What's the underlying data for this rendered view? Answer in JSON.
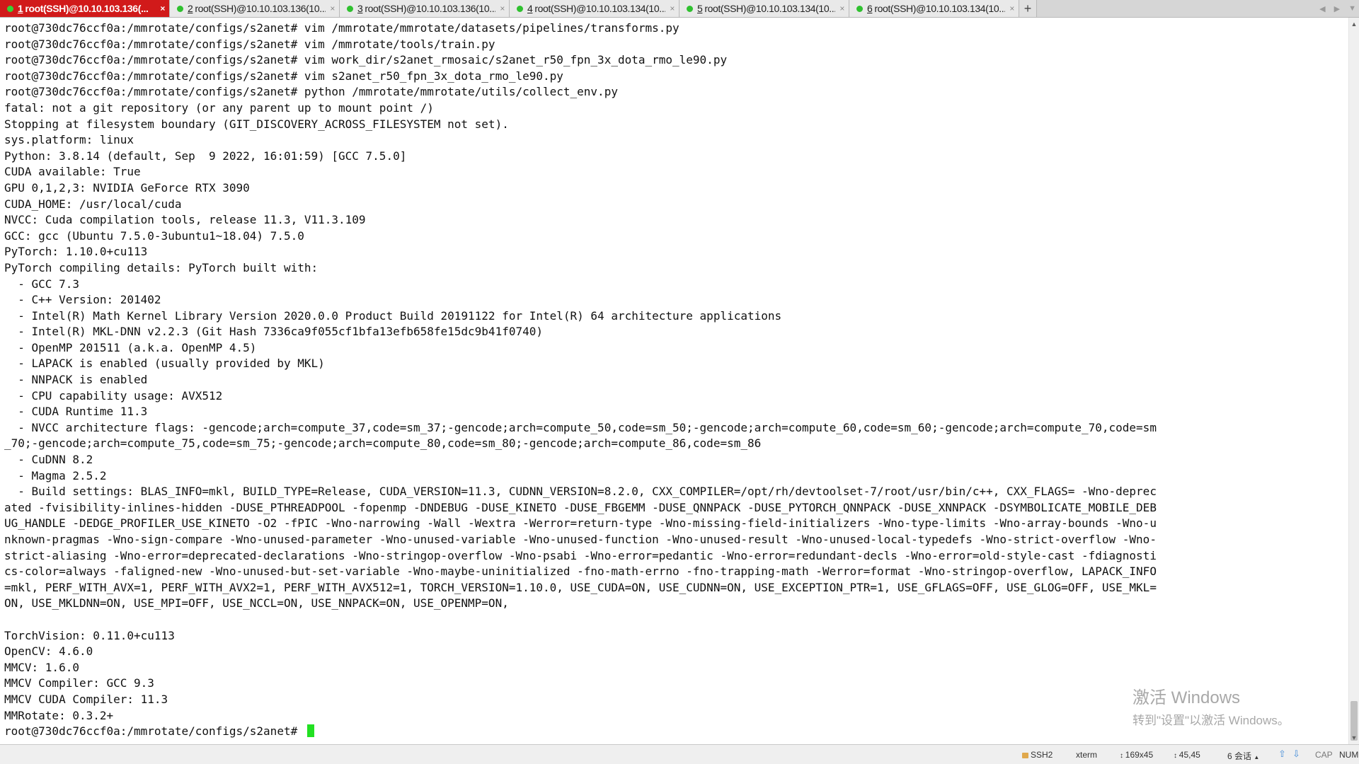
{
  "tabs": [
    {
      "num": "1",
      "title": "root(SSH)@10.10.103.136(...",
      "active": true
    },
    {
      "num": "2",
      "title": "root(SSH)@10.10.103.136(10...",
      "active": false
    },
    {
      "num": "3",
      "title": "root(SSH)@10.10.103.136(10...",
      "active": false
    },
    {
      "num": "4",
      "title": "root(SSH)@10.10.103.134(10...",
      "active": false
    },
    {
      "num": "5",
      "title": "root(SSH)@10.10.103.134(10...",
      "active": false
    },
    {
      "num": "6",
      "title": "root(SSH)@10.10.103.134(10...",
      "active": false
    }
  ],
  "tab_close_glyph": "×",
  "new_tab_glyph": "+",
  "terminal": {
    "lines": [
      "root@730dc76ccf0a:/mmrotate/configs/s2anet# vim /mmrotate/mmrotate/datasets/pipelines/transforms.py",
      "root@730dc76ccf0a:/mmrotate/configs/s2anet# vim /mmrotate/tools/train.py",
      "root@730dc76ccf0a:/mmrotate/configs/s2anet# vim work_dir/s2anet_rmosaic/s2anet_r50_fpn_3x_dota_rmo_le90.py",
      "root@730dc76ccf0a:/mmrotate/configs/s2anet# vim s2anet_r50_fpn_3x_dota_rmo_le90.py",
      "root@730dc76ccf0a:/mmrotate/configs/s2anet# python /mmrotate/mmrotate/utils/collect_env.py",
      "fatal: not a git repository (or any parent up to mount point /)",
      "Stopping at filesystem boundary (GIT_DISCOVERY_ACROSS_FILESYSTEM not set).",
      "sys.platform: linux",
      "Python: 3.8.14 (default, Sep  9 2022, 16:01:59) [GCC 7.5.0]",
      "CUDA available: True",
      "GPU 0,1,2,3: NVIDIA GeForce RTX 3090",
      "CUDA_HOME: /usr/local/cuda",
      "NVCC: Cuda compilation tools, release 11.3, V11.3.109",
      "GCC: gcc (Ubuntu 7.5.0-3ubuntu1~18.04) 7.5.0",
      "PyTorch: 1.10.0+cu113",
      "PyTorch compiling details: PyTorch built with:",
      "  - GCC 7.3",
      "  - C++ Version: 201402",
      "  - Intel(R) Math Kernel Library Version 2020.0.0 Product Build 20191122 for Intel(R) 64 architecture applications",
      "  - Intel(R) MKL-DNN v2.2.3 (Git Hash 7336ca9f055cf1bfa13efb658fe15dc9b41f0740)",
      "  - OpenMP 201511 (a.k.a. OpenMP 4.5)",
      "  - LAPACK is enabled (usually provided by MKL)",
      "  - NNPACK is enabled",
      "  - CPU capability usage: AVX512",
      "  - CUDA Runtime 11.3",
      "  - NVCC architecture flags: -gencode;arch=compute_37,code=sm_37;-gencode;arch=compute_50,code=sm_50;-gencode;arch=compute_60,code=sm_60;-gencode;arch=compute_70,code=sm",
      "_70;-gencode;arch=compute_75,code=sm_75;-gencode;arch=compute_80,code=sm_80;-gencode;arch=compute_86,code=sm_86",
      "  - CuDNN 8.2",
      "  - Magma 2.5.2",
      "  - Build settings: BLAS_INFO=mkl, BUILD_TYPE=Release, CUDA_VERSION=11.3, CUDNN_VERSION=8.2.0, CXX_COMPILER=/opt/rh/devtoolset-7/root/usr/bin/c++, CXX_FLAGS= -Wno-deprec",
      "ated -fvisibility-inlines-hidden -DUSE_PTHREADPOOL -fopenmp -DNDEBUG -DUSE_KINETO -DUSE_FBGEMM -DUSE_QNNPACK -DUSE_PYTORCH_QNNPACK -DUSE_XNNPACK -DSYMBOLICATE_MOBILE_DEB",
      "UG_HANDLE -DEDGE_PROFILER_USE_KINETO -O2 -fPIC -Wno-narrowing -Wall -Wextra -Werror=return-type -Wno-missing-field-initializers -Wno-type-limits -Wno-array-bounds -Wno-u",
      "nknown-pragmas -Wno-sign-compare -Wno-unused-parameter -Wno-unused-variable -Wno-unused-function -Wno-unused-result -Wno-unused-local-typedefs -Wno-strict-overflow -Wno-",
      "strict-aliasing -Wno-error=deprecated-declarations -Wno-stringop-overflow -Wno-psabi -Wno-error=pedantic -Wno-error=redundant-decls -Wno-error=old-style-cast -fdiagnosti",
      "cs-color=always -faligned-new -Wno-unused-but-set-variable -Wno-maybe-uninitialized -fno-math-errno -fno-trapping-math -Werror=format -Wno-stringop-overflow, LAPACK_INFO",
      "=mkl, PERF_WITH_AVX=1, PERF_WITH_AVX2=1, PERF_WITH_AVX512=1, TORCH_VERSION=1.10.0, USE_CUDA=ON, USE_CUDNN=ON, USE_EXCEPTION_PTR=1, USE_GFLAGS=OFF, USE_GLOG=OFF, USE_MKL=",
      "ON, USE_MKLDNN=ON, USE_MPI=OFF, USE_NCCL=ON, USE_NNPACK=ON, USE_OPENMP=ON,",
      "",
      "TorchVision: 0.11.0+cu113",
      "OpenCV: 4.6.0",
      "MMCV: 1.6.0",
      "MMCV Compiler: GCC 9.3",
      "MMCV CUDA Compiler: 11.3",
      "MMRotate: 0.3.2+"
    ],
    "prompt": "root@730dc76ccf0a:/mmrotate/configs/s2anet#",
    "cursor_color": "#22e022"
  },
  "watermark": {
    "line1": "激活 Windows",
    "line2": "转到\"设置\"以激活 Windows。"
  },
  "status": {
    "protocol": "SSH2",
    "terminal_type": "xterm",
    "size": "169x45",
    "cursor_pos": "45,45",
    "sessions": "6 会话",
    "cap": "CAP",
    "num": "NUM"
  },
  "colors": {
    "active_tab": "#d11a1a",
    "session_dot": "#2fc12f",
    "status_arrows": "#4a90d9"
  },
  "icons": {
    "scroll_up": "▲",
    "scroll_down": "▼",
    "tab_prev": "◀",
    "tab_next": "▶",
    "tab_menu": "▼",
    "status_up": "⇧",
    "status_down": "⇩",
    "session_caret": "▲"
  }
}
